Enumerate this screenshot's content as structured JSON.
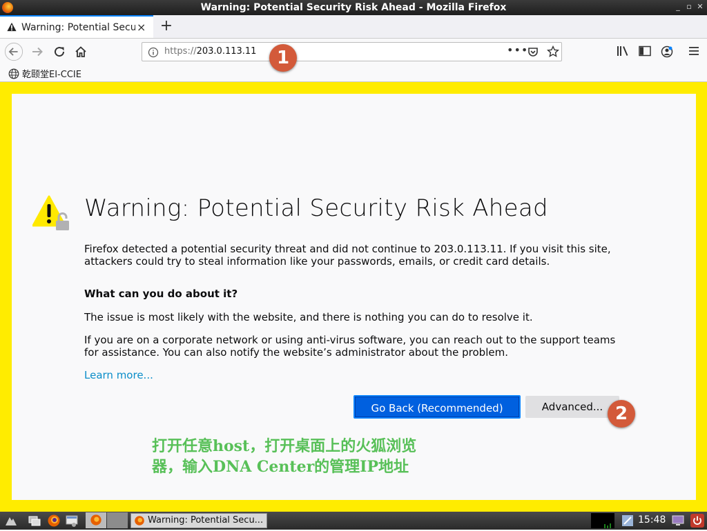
{
  "window": {
    "title": "Warning: Potential Security Risk Ahead - Mozilla Firefox",
    "min_glyph": "_",
    "max_glyph": "▫",
    "close_glyph": "✕"
  },
  "tab": {
    "label": "Warning: Potential Securi",
    "close_glyph": "×",
    "new_tab_glyph": "+"
  },
  "urlbar": {
    "protocol": "https://",
    "host": "203.0.113.11",
    "page_actions_glyph": "•••"
  },
  "bookmarks": [
    {
      "label": "乾颐堂EI-CCIE",
      "icon": "globe-icon"
    }
  ],
  "page": {
    "heading": "Warning: Potential Security Risk Ahead",
    "intro": "Firefox detected a potential security threat and did not continue to 203.0.113.11. If you visit this site, attackers could try to steal information like your passwords, emails, or credit card details.",
    "question": "What can you do about it?",
    "para1": "The issue is most likely with the website, and there is nothing you can do to resolve it.",
    "para2": "If you are on a corporate network or using anti-virus software, you can reach out to the support teams for assistance. You can also notify the website’s administrator about the problem.",
    "learn_more": "Learn more...",
    "go_back": "Go Back (Recommended)",
    "advanced": "Advanced..."
  },
  "annotations": {
    "badge1": "1",
    "badge2": "2",
    "caption_line1": "打开任意host，打开桌面上的火狐浏览",
    "caption_line2": "器，输入DNA Center的管理IP地址"
  },
  "taskbar": {
    "window_label": "Warning: Potential Secu...",
    "clock": "15:48"
  },
  "colors": {
    "frame_yellow": "#ffec00",
    "primary_button": "#0060df",
    "link": "#0a8dc9",
    "badge": "#d35a3a",
    "caption_green": "#58c058"
  }
}
